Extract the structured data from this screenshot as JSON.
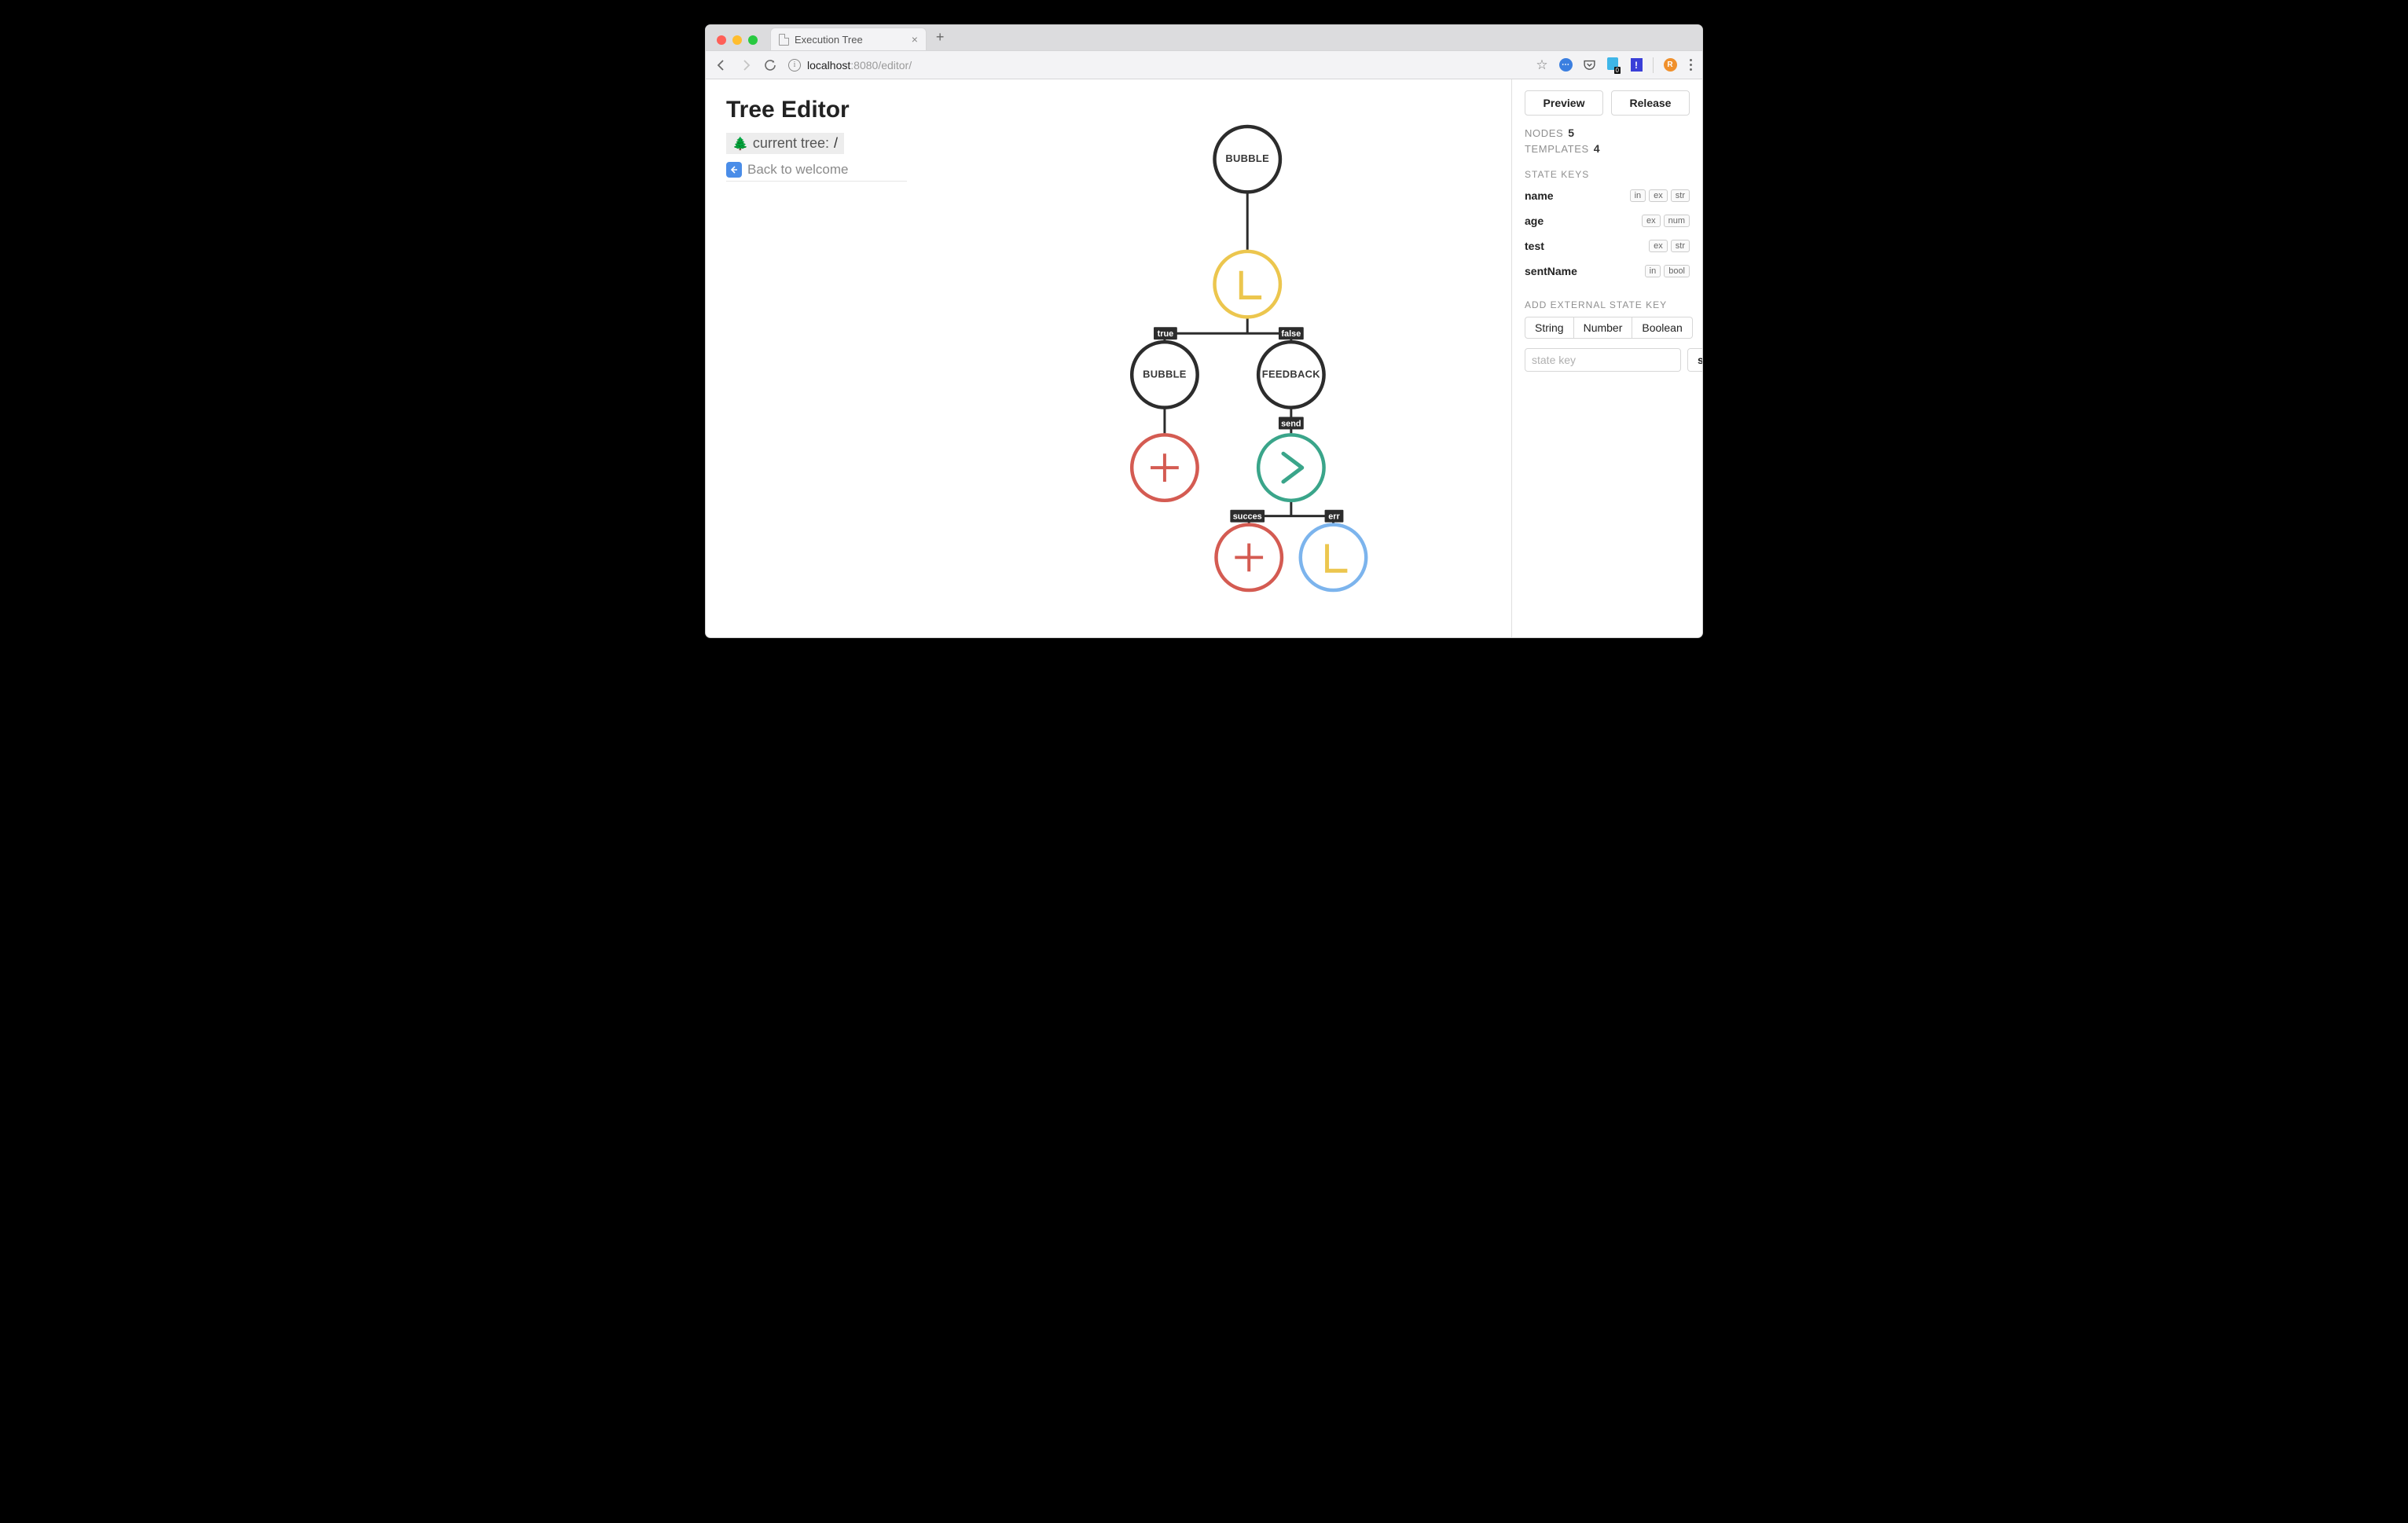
{
  "browser": {
    "tab_title": "Execution Tree",
    "url_host": "localhost",
    "url_port": ":8080",
    "url_path": "/editor/"
  },
  "header": {
    "title": "Tree Editor",
    "current_tree_label": "current tree:",
    "current_tree_path": "/",
    "back_label": "Back to welcome"
  },
  "tree": {
    "nodes": {
      "root": {
        "label": "BUBBLE"
      },
      "cond": {
        "icon": "L"
      },
      "left": {
        "label": "BUBBLE"
      },
      "right": {
        "label": "FEEDBACK"
      },
      "leftAdd": {
        "icon": "+"
      },
      "send": {
        "icon": ">"
      },
      "succAdd": {
        "icon": "+"
      },
      "errCond": {
        "icon": "L"
      }
    },
    "edges": {
      "cond_left": "true",
      "cond_right": "false",
      "right_send": "send",
      "send_succ": "succes",
      "send_err": "err"
    }
  },
  "sidebar": {
    "preview": "Preview",
    "release": "Release",
    "nodes_label": "Nodes",
    "nodes_count": "5",
    "templates_label": "Templates",
    "templates_count": "4",
    "state_keys_label": "State Keys",
    "keys": [
      {
        "name": "name",
        "tags": [
          "in",
          "ex",
          "str"
        ]
      },
      {
        "name": "age",
        "tags": [
          "ex",
          "num"
        ]
      },
      {
        "name": "test",
        "tags": [
          "ex",
          "str"
        ]
      },
      {
        "name": "sentName",
        "tags": [
          "in",
          "bool"
        ]
      }
    ],
    "add_ext_label": "Add external state key",
    "seg": [
      "String",
      "Number",
      "Boolean"
    ],
    "input_placeholder": "state key",
    "save": "save"
  }
}
